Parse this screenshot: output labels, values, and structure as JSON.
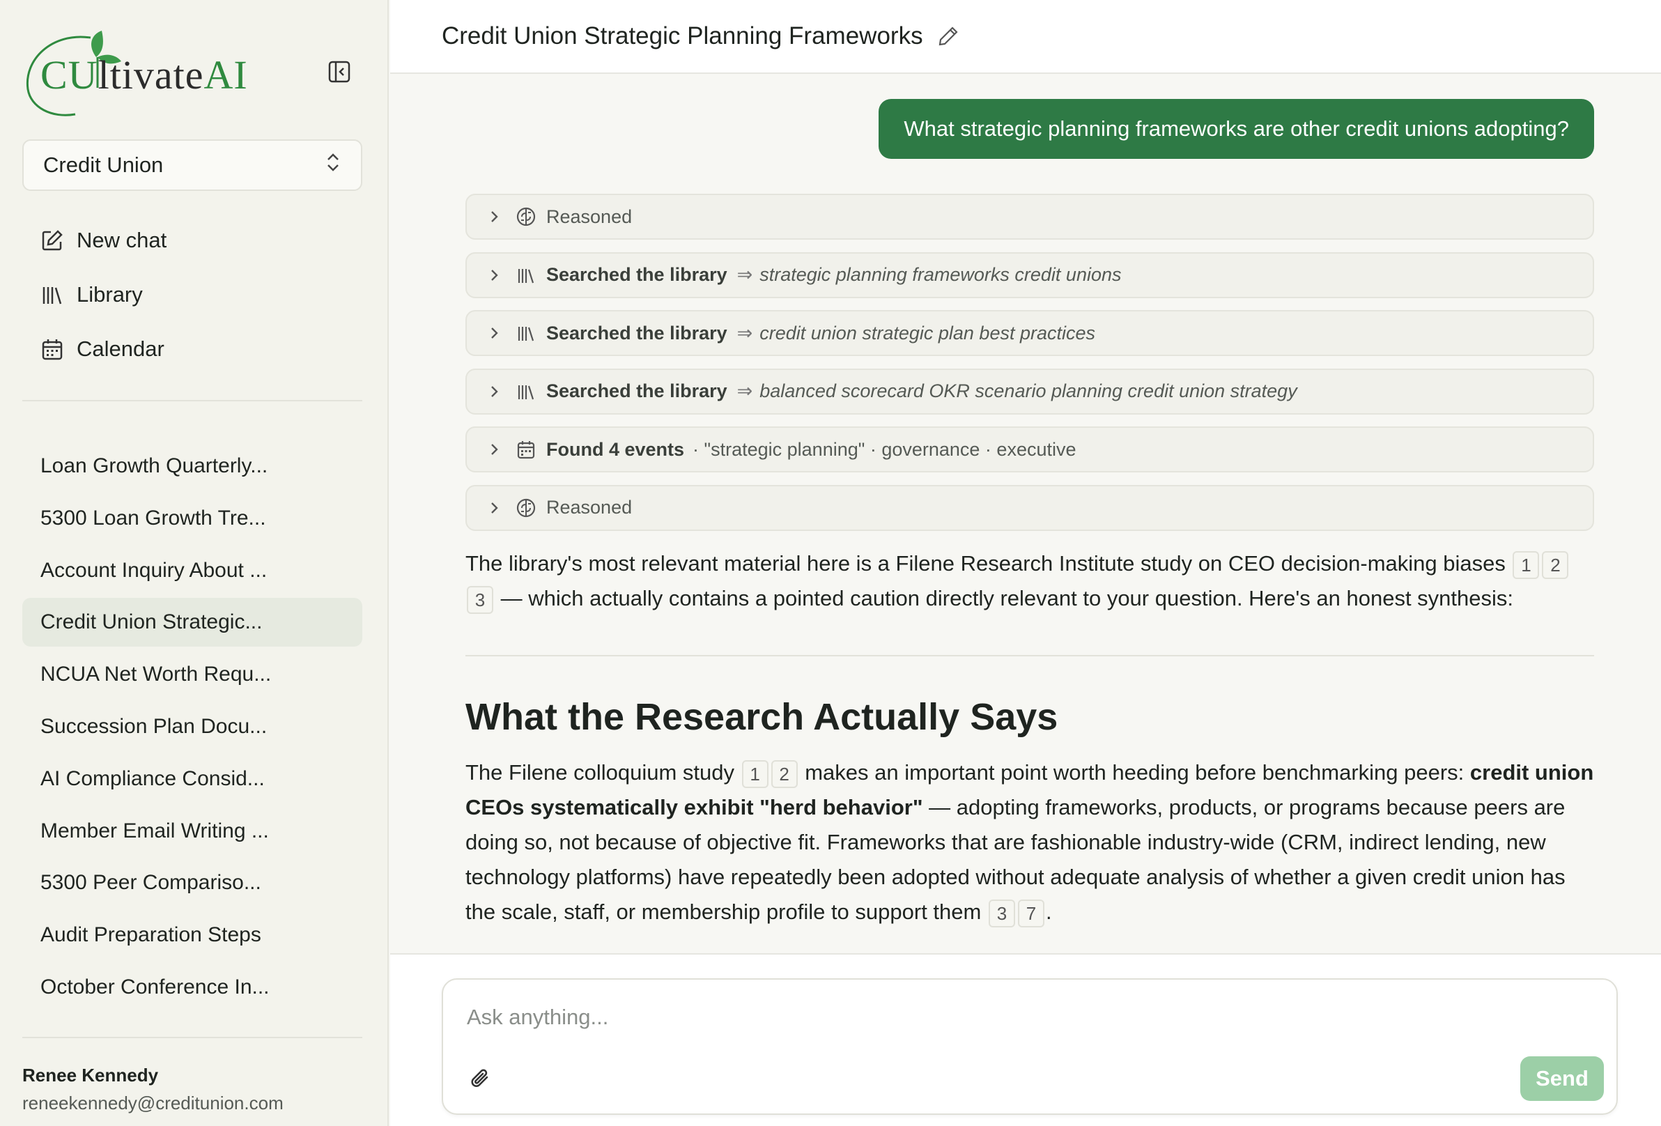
{
  "brand": {
    "prefix": "CU",
    "middle": "l",
    "suffix": "tivate",
    "ai": "AI",
    "green": "#2f8a3f"
  },
  "sidebar": {
    "workspace": "Credit Union",
    "nav": [
      {
        "label": "New chat",
        "icon": "edit-square-icon"
      },
      {
        "label": "Library",
        "icon": "library-icon"
      },
      {
        "label": "Calendar",
        "icon": "calendar-icon"
      }
    ],
    "chats": [
      "Loan Growth Quarterly...",
      "5300 Loan Growth Tre...",
      "Account Inquiry About ...",
      "Credit Union Strategic...",
      "NCUA Net Worth Requ...",
      "Succession Plan Docu...",
      "AI Compliance Consid...",
      "Member Email Writing ...",
      "5300 Peer Compariso...",
      "Audit Preparation Steps",
      "October Conference In..."
    ],
    "active_chat_index": 3,
    "user": {
      "name": "Renee Kennedy",
      "email": "reneekennedy@creditunion.com"
    }
  },
  "header": {
    "title": "Credit Union Strategic Planning Frameworks"
  },
  "conversation": {
    "user_message": "What strategic planning frameworks are other credit unions adopting?",
    "steps": [
      {
        "label": "Reasoned"
      },
      {
        "label": "Searched the library",
        "arrow": "⇒",
        "query": "strategic planning frameworks credit unions"
      },
      {
        "label": "Searched the library",
        "arrow": "⇒",
        "query": "credit union strategic plan best practices"
      },
      {
        "label": "Searched the library",
        "arrow": "⇒",
        "query": "balanced scorecard OKR scenario planning credit union strategy"
      },
      {
        "label": "Found 4 events",
        "meta": "· \"strategic planning\" · governance · executive"
      },
      {
        "label": "Reasoned"
      }
    ],
    "intro": {
      "text1": "The library's most relevant material here is a Filene Research Institute study on CEO decision-making biases",
      "text2": "— which actually contains a pointed caution directly relevant to your question. Here's an honest synthesis:",
      "cites": [
        "1",
        "2",
        "3"
      ]
    },
    "section_heading": "What the Research Actually Says",
    "body": {
      "p1": "The Filene colloquium study",
      "p1_cites": [
        "1",
        "2"
      ],
      "p2": "makes an important point worth heeding before benchmarking peers:",
      "bold": "credit union CEOs systematically exhibit \"herd behavior\"",
      "p3": "— adopting frameworks, products, or programs because peers are doing so, not because of objective fit. Frameworks that are fashionable industry-wide (CRM, indirect lending, new technology platforms) have repeatedly been adopted without adequate analysis of whether a given credit union has the scale, staff, or membership profile to support them",
      "p3_cites": [
        "3",
        "7"
      ],
      "end": "."
    }
  },
  "composer": {
    "placeholder": "Ask anything...",
    "send_label": "Send"
  }
}
